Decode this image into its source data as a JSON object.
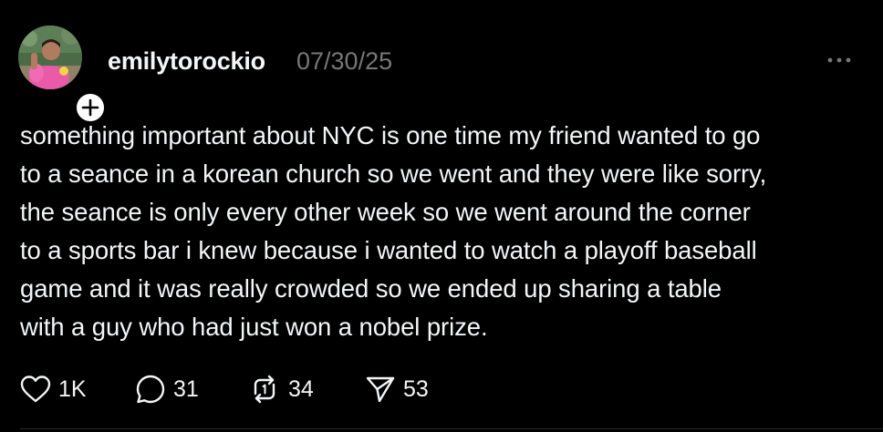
{
  "post": {
    "username": "emilytorockio",
    "timestamp": "07/30/25",
    "text": "something important about NYC is one time my friend wanted to go\nto a seance in a korean church so we went and they were like sorry,\nthe seance is only every other week so we went around the corner\nto a sports bar i knew because i wanted to watch a playoff baseball\ngame and it was really crowded so we ended up sharing a table\nwith a guy who had just won a nobel prize.",
    "icons": {
      "more": "more-horizontal-icon",
      "follow": "plus-icon"
    }
  },
  "actions": {
    "like": {
      "icon": "heart-icon",
      "count": "1K"
    },
    "reply": {
      "icon": "comment-bubble-icon",
      "count": "31"
    },
    "repost": {
      "icon": "repost-icon",
      "count": "34"
    },
    "share": {
      "icon": "send-icon",
      "count": "53"
    }
  },
  "colors": {
    "background": "#000000",
    "text": "#f3f5f7",
    "secondary_text": "#777777"
  }
}
